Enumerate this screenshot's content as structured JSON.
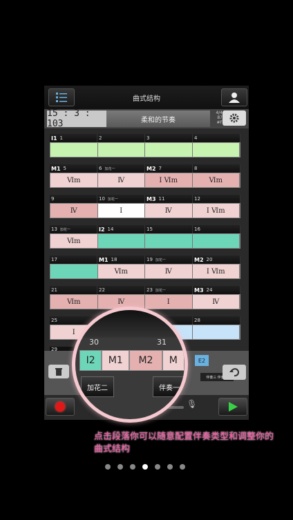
{
  "header": {
    "title": "曲式结构",
    "menu_icon": "list-icon",
    "user_icon": "user-icon"
  },
  "info": {
    "time": "15 : 3 : 103",
    "style": "柔和的节奏",
    "meter": [
      "4/4",
      "87",
      "#F"
    ],
    "settings_icon": "gear-icon"
  },
  "rows": [
    {
      "bars": [
        {
          "sec": "I1",
          "num": "1",
          "tag": ""
        },
        {
          "sec": "",
          "num": "2",
          "tag": ""
        },
        {
          "sec": "",
          "num": "3",
          "tag": ""
        },
        {
          "sec": "",
          "num": "4",
          "tag": ""
        }
      ],
      "cells": [
        {
          "c": "green",
          "t": ""
        },
        {
          "c": "green",
          "t": ""
        },
        {
          "c": "green",
          "t": ""
        },
        {
          "c": "green",
          "t": ""
        }
      ]
    },
    {
      "bars": [
        {
          "sec": "M1",
          "num": "5",
          "tag": ""
        },
        {
          "sec": "",
          "num": "6",
          "tag": "加花一"
        },
        {
          "sec": "M2",
          "num": "7",
          "tag": ""
        },
        {
          "sec": "",
          "num": "8",
          "tag": ""
        }
      ],
      "cells": [
        {
          "c": "pink",
          "t": "Ⅵm"
        },
        {
          "c": "pink",
          "t": "Ⅳ"
        },
        {
          "c": "rose",
          "t": "Ⅰ   Ⅵm"
        },
        {
          "c": "rose",
          "t": "Ⅵm"
        }
      ]
    },
    {
      "bars": [
        {
          "sec": "",
          "num": "9",
          "tag": ""
        },
        {
          "sec": "",
          "num": "10",
          "tag": "加花一"
        },
        {
          "sec": "M3",
          "num": "11",
          "tag": ""
        },
        {
          "sec": "",
          "num": "12",
          "tag": ""
        }
      ],
      "cells": [
        {
          "c": "rose",
          "t": "Ⅳ"
        },
        {
          "c": "white",
          "t": "Ⅰ"
        },
        {
          "c": "pink",
          "t": "Ⅳ"
        },
        {
          "c": "pink",
          "t": "Ⅰ   Ⅵm"
        }
      ]
    },
    {
      "bars": [
        {
          "sec": "",
          "num": "13",
          "tag": "加花一"
        },
        {
          "sec": "I2",
          "num": "14",
          "tag": ""
        },
        {
          "sec": "",
          "num": "15",
          "tag": ""
        },
        {
          "sec": "",
          "num": "16",
          "tag": ""
        }
      ],
      "cells": [
        {
          "c": "pink",
          "t": "Ⅵm"
        },
        {
          "c": "teal",
          "t": ""
        },
        {
          "c": "teal",
          "t": ""
        },
        {
          "c": "teal",
          "t": ""
        }
      ]
    },
    {
      "bars": [
        {
          "sec": "",
          "num": "17",
          "tag": ""
        },
        {
          "sec": "M1",
          "num": "18",
          "tag": ""
        },
        {
          "sec": "",
          "num": "19",
          "tag": "加花一"
        },
        {
          "sec": "M2",
          "num": "20",
          "tag": ""
        }
      ],
      "cells": [
        {
          "c": "teal",
          "t": ""
        },
        {
          "c": "pink",
          "t": "Ⅵm"
        },
        {
          "c": "pink",
          "t": "Ⅳ"
        },
        {
          "c": "pink",
          "t": "Ⅰ   Ⅵm"
        }
      ]
    },
    {
      "bars": [
        {
          "sec": "",
          "num": "21",
          "tag": ""
        },
        {
          "sec": "",
          "num": "22",
          "tag": ""
        },
        {
          "sec": "",
          "num": "23",
          "tag": "加花一"
        },
        {
          "sec": "M3",
          "num": "24",
          "tag": ""
        }
      ],
      "cells": [
        {
          "c": "rose",
          "t": "Ⅵm"
        },
        {
          "c": "rose",
          "t": "Ⅳ"
        },
        {
          "c": "rose",
          "t": "Ⅰ"
        },
        {
          "c": "pink",
          "t": "Ⅳ"
        }
      ]
    },
    {
      "bars": [
        {
          "sec": "",
          "num": "25",
          "tag": ""
        },
        {
          "sec": "",
          "num": "",
          "tag": ""
        },
        {
          "sec": "",
          "num": "",
          "tag": ""
        },
        {
          "sec": "",
          "num": "28",
          "tag": ""
        }
      ],
      "cells": [
        {
          "c": "pink",
          "t": "Ⅰ"
        },
        {
          "c": "pink",
          "t": ""
        },
        {
          "c": "blue",
          "t": ""
        },
        {
          "c": "blue",
          "t": ""
        }
      ]
    }
  ],
  "extra_bar_num": "29",
  "bottom": {
    "e2": "E2",
    "mini_label": "伴奏三 伴奏四",
    "trash_icon": "trash-icon",
    "undo_icon": "undo-icon"
  },
  "magnifier": {
    "n30": "30",
    "n31": "31",
    "cells": [
      {
        "c": "teal",
        "t": "I2"
      },
      {
        "c": "pink",
        "t": "M1"
      },
      {
        "c": "rose",
        "t": "M2"
      },
      {
        "c": "pink",
        "t": "M"
      }
    ],
    "btn_left": "加花二",
    "btn_right": "伴奏一"
  },
  "transport": {
    "record_icon": "record-icon",
    "play_icon": "play-icon",
    "mic_icon": "microphone-icon"
  },
  "caption": "点击段落你可以随意配置伴奏类型和调整你的曲式结构",
  "pager": {
    "count": 7,
    "active": 3
  }
}
